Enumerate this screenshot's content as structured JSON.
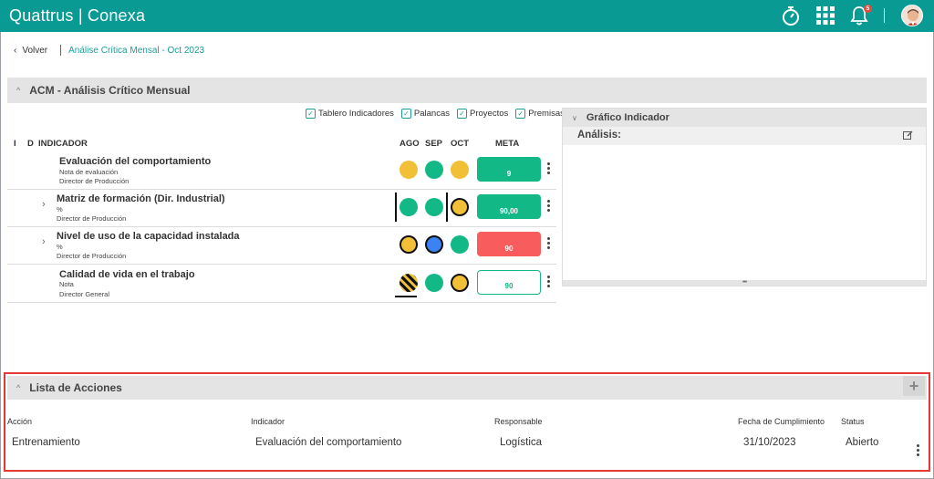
{
  "app": {
    "brand": "Quattrus | Conexa",
    "notification_count": "5"
  },
  "breadcrumb": {
    "back_label": "Volver",
    "current": "Análise Crítica Mensal - Oct 2023"
  },
  "acm": {
    "title": "ACM - Análisis Crítico Mensual",
    "filters": [
      {
        "label": "Tablero Indicadores",
        "checked": true
      },
      {
        "label": "Palancas",
        "checked": true
      },
      {
        "label": "Proyectos",
        "checked": true
      },
      {
        "label": "Premisas",
        "checked": true
      }
    ],
    "columns": {
      "i": "I",
      "d": "D",
      "indicator": "INDICADOR",
      "m1": "AGO",
      "m2": "SEP",
      "m3": "OCT",
      "goal": "META"
    },
    "rows": [
      {
        "name": "Evaluación del comportamiento",
        "unit": "Nota de evaluación",
        "responsible": "Director de Producción",
        "goal": "9",
        "expandable": false,
        "statuses": [
          "yellow",
          "green",
          "yellow"
        ],
        "goal_status": "green"
      },
      {
        "name": "Matriz de formación (Dir. Industrial)",
        "unit": "%",
        "responsible": "Director de Producción",
        "goal": "90,00",
        "expandable": true,
        "statuses": [
          "green",
          "green",
          "yellow"
        ],
        "goal_status": "green"
      },
      {
        "name": "Nivel de uso de la capacidad instalada",
        "unit": "%",
        "responsible": "Director de Producción",
        "goal": "90",
        "expandable": true,
        "statuses": [
          "yellow",
          "blue",
          "green"
        ],
        "goal_status": "red"
      },
      {
        "name": "Calidad de vida en el trabajo",
        "unit": "Nota",
        "responsible": "Director General",
        "goal": "90",
        "expandable": false,
        "statuses": [
          "striped",
          "green",
          "yellow"
        ],
        "goal_status": "outline"
      }
    ]
  },
  "chart_panel": {
    "title": "Gráfico Indicador",
    "analysis_label": "Análisis:"
  },
  "actions": {
    "title": "Lista de Acciones",
    "headers": {
      "action": "Acción",
      "indicator": "Indicador",
      "responsible": "Responsable",
      "due": "Fecha de Cumplimiento",
      "status": "Status"
    },
    "rows": [
      {
        "action": "Entrenamiento",
        "indicator": "Evaluación del comportamiento",
        "responsible": "Logística",
        "due": "31/10/2023",
        "status": "Abierto"
      }
    ]
  },
  "colors": {
    "brand": "#0a9a94",
    "green": "#12b886",
    "yellow": "#f2c037",
    "red": "#f85c5c",
    "blue": "#3b82f6",
    "highlight": "#e53935"
  }
}
